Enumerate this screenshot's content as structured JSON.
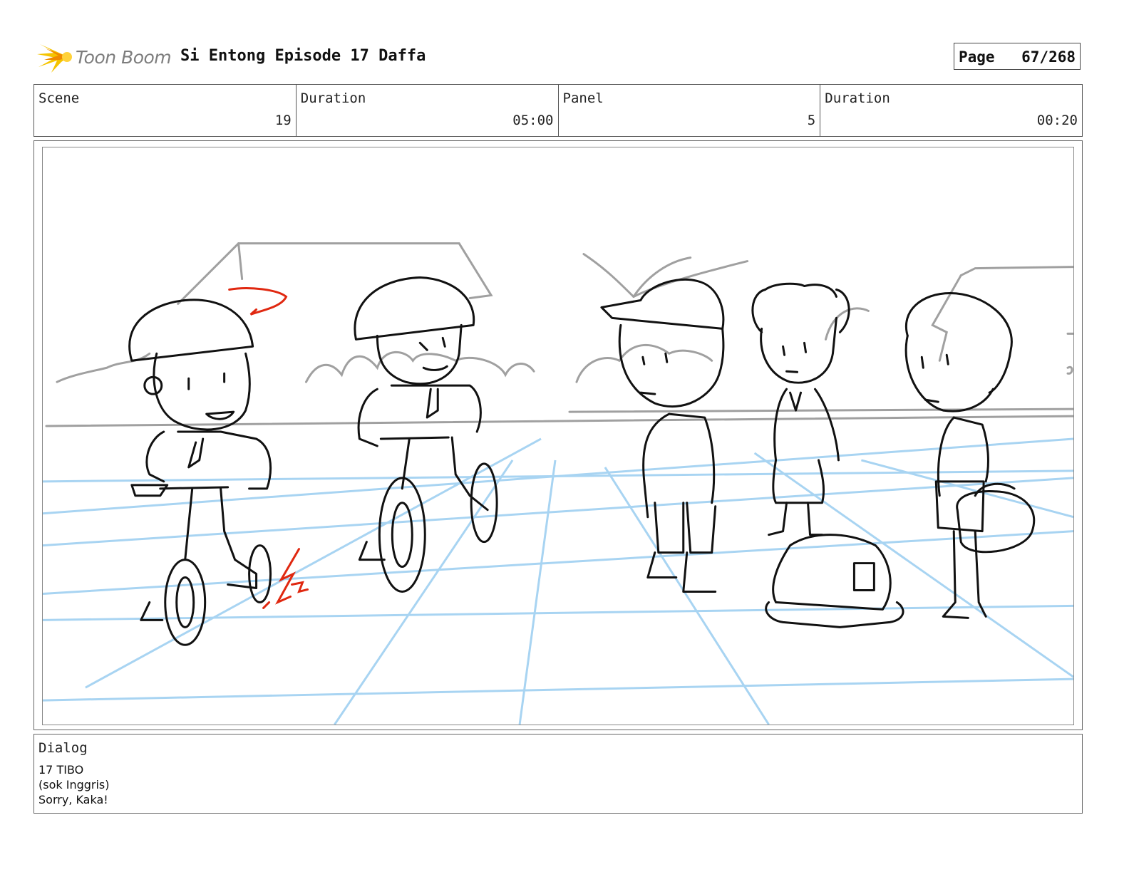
{
  "header": {
    "logo_text": "Toon Boom",
    "title": "Si Entong Episode 17 Daffa",
    "page_label": "Page",
    "page_number": "67/268"
  },
  "info": {
    "scene_label": "Scene",
    "scene_value": "19",
    "scene_duration_label": "Duration",
    "scene_duration_value": "05:00",
    "panel_label": "Panel",
    "panel_value": "5",
    "panel_duration_label": "Duration",
    "panel_duration_value": "00:20"
  },
  "dialog": {
    "label": "Dialog",
    "lines": [
      "17 TIBO",
      "(sok Inggris)",
      "Sorry, Kaka!"
    ]
  },
  "colors": {
    "guide_blue": "#a8d4f2",
    "sketch_gray": "#a0a0a0",
    "ink": "#111111",
    "annotation_red": "#e02810",
    "logo_star": "#f5c400"
  }
}
